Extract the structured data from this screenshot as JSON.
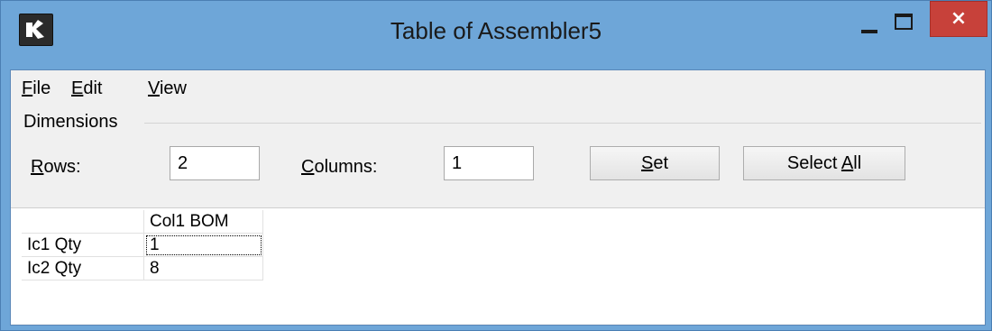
{
  "window": {
    "title": "Table of Assembler5",
    "close_glyph": "×"
  },
  "menu": {
    "file": {
      "mnemonic": "F",
      "rest": "ile"
    },
    "edit": {
      "mnemonic": "E",
      "rest": "dit"
    },
    "view": {
      "mnemonic": "V",
      "rest": "iew"
    }
  },
  "dimensions": {
    "group_label": "Dimensions",
    "rows_label": {
      "mnemonic": "R",
      "rest": "ows:"
    },
    "rows_value": "2",
    "columns_label": {
      "mnemonic": "C",
      "rest": "olumns:"
    },
    "columns_value": "1",
    "set_button": {
      "mnemonic": "S",
      "rest": "et"
    },
    "select_all_button": {
      "prefix": "Select ",
      "mnemonic": "A",
      "rest": "ll"
    }
  },
  "grid": {
    "column_headers": [
      "Col1 BOM"
    ],
    "rows": [
      {
        "header": "Ic1 Qty",
        "cells": [
          "1"
        ]
      },
      {
        "header": "Ic2 Qty",
        "cells": [
          "8"
        ]
      }
    ]
  }
}
